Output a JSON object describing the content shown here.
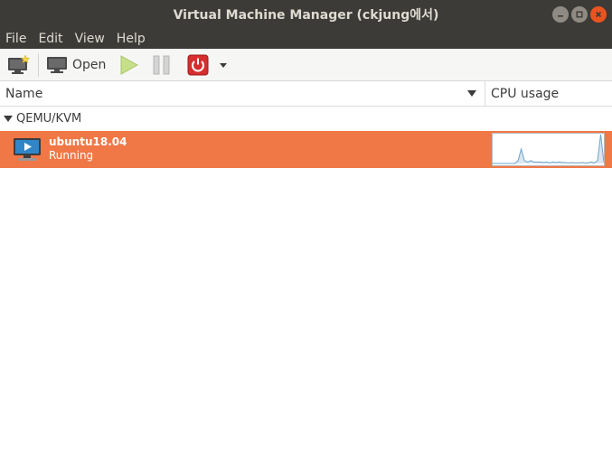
{
  "window": {
    "title": "Virtual Machine Manager (ckjung에서)"
  },
  "menu": [
    "File",
    "Edit",
    "View",
    "Help"
  ],
  "toolbar": {
    "open_label": "Open"
  },
  "columns": {
    "name": "Name",
    "cpu": "CPU usage"
  },
  "group": {
    "label": "QEMU/KVM"
  },
  "vm": {
    "name": "ubuntu18.04",
    "status": "Running",
    "cpu_history": [
      0,
      0,
      0,
      0,
      0,
      0,
      0,
      0,
      0.1,
      0.5,
      0.1,
      0.05,
      0.1,
      0.05,
      0.05,
      0.05,
      0.03,
      0.05,
      0.02,
      0.05,
      0.03,
      0.05,
      0.03,
      0.03,
      0.02,
      0.03,
      0.02,
      0.02,
      0.03,
      0.02,
      0.02,
      0.05,
      0.02,
      0.1,
      1.0,
      0.05
    ]
  },
  "colors": {
    "selection": "#f07746",
    "titlebar": "#3c3b37",
    "graph_line": "#6ea3c8",
    "graph_fill": "#d7e6f1"
  }
}
